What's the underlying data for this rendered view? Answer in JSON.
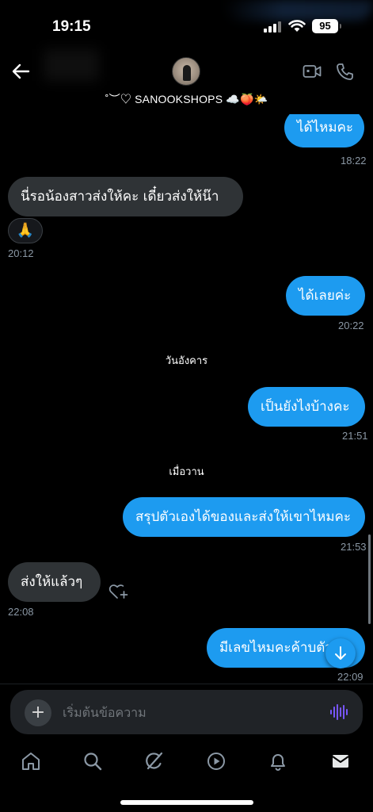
{
  "status_bar": {
    "time": "19:15",
    "battery": "95"
  },
  "header": {
    "contact_name": "˚︶♡ SANOOKSHOPS ☁️🍑🌤️",
    "icons": [
      "back-arrow-icon",
      "video-call-icon",
      "phone-call-icon"
    ]
  },
  "messages": [
    {
      "direction": "out",
      "text": "ได้ไหมคะ",
      "time": "18:22"
    },
    {
      "direction": "in",
      "text": "นี่รอน้องสาวส่งให้คะ เดี๋ยวส่งให้น๊า",
      "time": ""
    },
    {
      "direction": "in",
      "text": "🙏",
      "time": "20:12"
    },
    {
      "direction": "out",
      "text": "ได้เลยค่ะ",
      "time": "20:22"
    },
    {
      "direction": "out",
      "text": "เป็นยังไงบ้างคะ",
      "time": "21:51"
    },
    {
      "direction": "out",
      "text": "สรุปตัวเองได้ของและส่งให้เขาไหมคะ",
      "time": "21:53"
    },
    {
      "direction": "in",
      "text": "ส่งให้แล้วๆ",
      "time": "22:08"
    },
    {
      "direction": "out",
      "text": "มีเลขไหมคะค้าบตัว",
      "time": "22:09"
    }
  ],
  "day_separators": [
    "วันอังคาร",
    "เมื่อวาน"
  ],
  "composer": {
    "placeholder": "เริ่มต้นข้อความ",
    "plus_label": "+"
  },
  "tabbar": {
    "items": [
      "home-icon",
      "search-icon",
      "grok-icon",
      "video-icon",
      "notifications-icon",
      "messages-icon"
    ],
    "active": "messages-icon"
  },
  "colors": {
    "accent": "#1d9bf0",
    "incoming_bubble": "#2f3336",
    "timestamp": "#8b98a5",
    "background": "#000000",
    "voice_icon": "#7856ff"
  }
}
